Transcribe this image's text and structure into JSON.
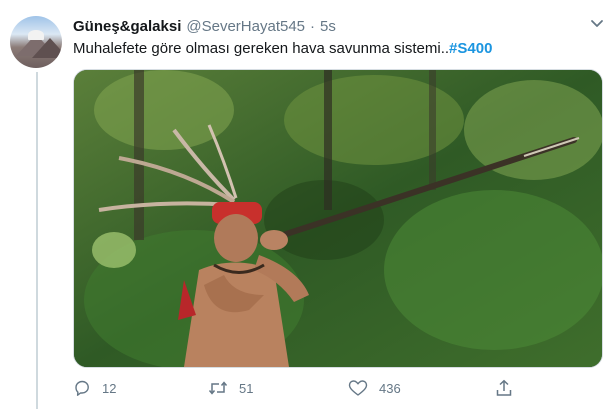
{
  "tweet": {
    "display_name": "Güneş&galaksi",
    "handle": "@SeverHayat545",
    "separator": "·",
    "time": "5s",
    "text": "Muhalefete göre olması gereken hava savunma sistemi..",
    "hashtag": "#S400",
    "more_icon": "chevron-down-icon"
  },
  "media": {
    "description_icon": "photo"
  },
  "actions": {
    "reply_count": "12",
    "retweet_count": "51",
    "like_count": "436",
    "reply_icon": "comment-icon",
    "retweet_icon": "retweet-icon",
    "like_icon": "heart-icon",
    "share_icon": "share-icon"
  },
  "colors": {
    "hashtag": "#1b95e0",
    "secondary_text": "#657786",
    "primary_text": "#14171a"
  }
}
